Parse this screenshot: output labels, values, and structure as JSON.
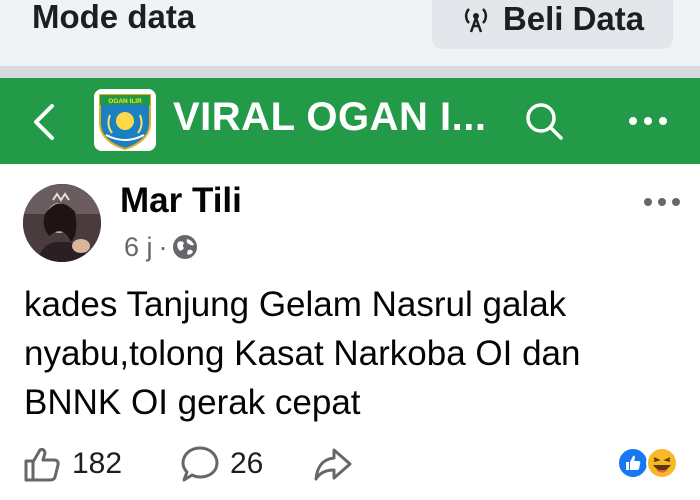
{
  "data_banner": {
    "title": "Mode data",
    "buy_button_label": "Beli Data",
    "buy_button_icon": "broadcast-icon"
  },
  "group_header": {
    "back_icon": "chevron-left-icon",
    "name": "VIRAL OGAN I...",
    "logo_text": "OGAN ILIR",
    "search_icon": "search-icon",
    "more_icon": "more-horizontal-icon",
    "background_color": "#239a48"
  },
  "post": {
    "author": "Mar Tili",
    "time": "6 j",
    "separator": "·",
    "privacy_icon": "globe-icon",
    "text": "kades Tanjung Gelam Nasrul galak\nnyabu,tolong Kasat Narkoba OI dan\nBNNK OI gerak cepat"
  },
  "actions": {
    "like_count": "182",
    "comment_count": "26",
    "like_icon": "thumbs-up-icon",
    "comment_icon": "comment-bubble-icon",
    "share_icon": "share-arrow-icon",
    "reactions": [
      "like-reaction-icon",
      "haha-reaction-icon"
    ]
  }
}
